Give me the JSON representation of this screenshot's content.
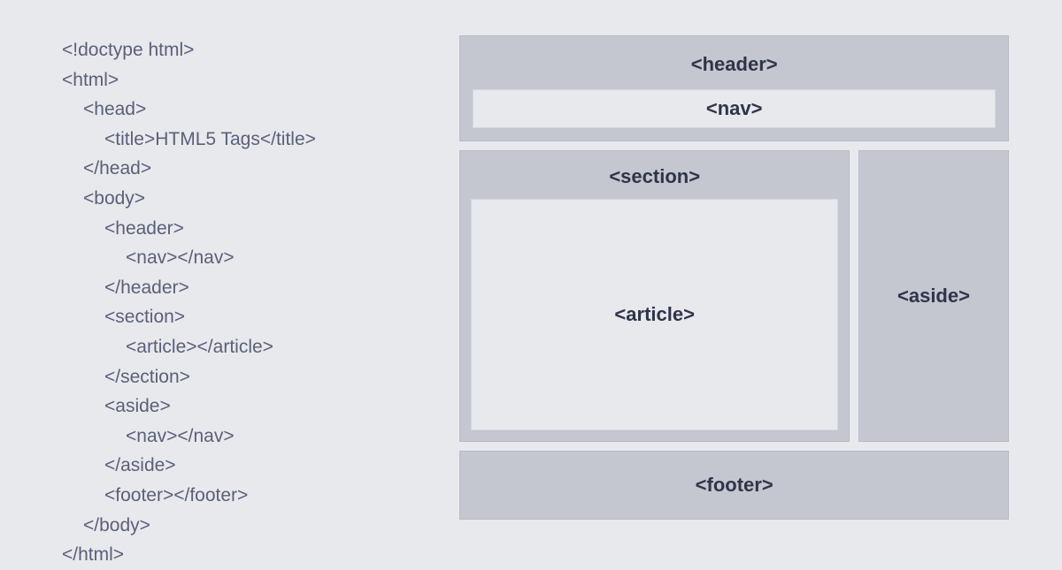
{
  "code": {
    "lines": [
      {
        "indent": 0,
        "text": "<!doctype html>"
      },
      {
        "indent": 0,
        "text": "<html>"
      },
      {
        "indent": 1,
        "text": "<head>"
      },
      {
        "indent": 2,
        "text": "<title>HTML5 Tags</title>"
      },
      {
        "indent": 1,
        "text": "</head>"
      },
      {
        "indent": 1,
        "text": "<body>"
      },
      {
        "indent": 2,
        "text": "<header>"
      },
      {
        "indent": 3,
        "text": "<nav></nav>"
      },
      {
        "indent": 2,
        "text": "</header>"
      },
      {
        "indent": 2,
        "text": "<section>"
      },
      {
        "indent": 3,
        "text": "<article></article>"
      },
      {
        "indent": 2,
        "text": "</section>"
      },
      {
        "indent": 2,
        "text": "<aside>"
      },
      {
        "indent": 3,
        "text": "<nav></nav>"
      },
      {
        "indent": 2,
        "text": "</aside>"
      },
      {
        "indent": 2,
        "text": "<footer></footer>"
      },
      {
        "indent": 1,
        "text": "</body>"
      },
      {
        "indent": 0,
        "text": "</html>"
      }
    ]
  },
  "layout": {
    "header_label": "<header>",
    "nav_label": "<nav>",
    "section_label": "<section>",
    "article_label": "<article>",
    "aside_label": "<aside>",
    "footer_label": "<footer>"
  }
}
